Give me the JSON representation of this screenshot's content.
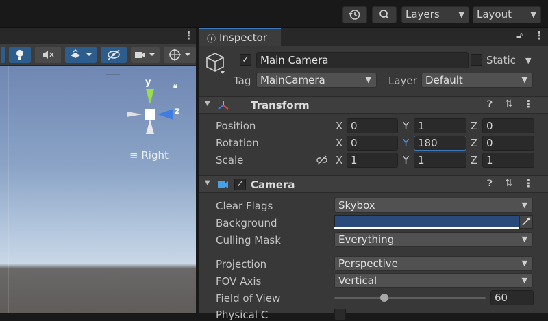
{
  "toolbar": {
    "layers_label": "Layers",
    "layout_label": "Layout"
  },
  "scene": {
    "view_label": "Right",
    "gizmo_y": "y",
    "gizmo_z": "z"
  },
  "inspector": {
    "tab_label": "Inspector",
    "object_name": "Main Camera",
    "static_label": "Static",
    "static_checked": false,
    "active_checked": true,
    "tag_label": "Tag",
    "tag_value": "MainCamera",
    "layer_label": "Layer",
    "layer_value": "Default",
    "transform": {
      "title": "Transform",
      "position_label": "Position",
      "rotation_label": "Rotation",
      "scale_label": "Scale",
      "position": {
        "x": "0",
        "y": "1",
        "z": "0"
      },
      "rotation": {
        "x": "0",
        "y": "180",
        "z": "0"
      },
      "scale": {
        "x": "1",
        "y": "1",
        "z": "1"
      },
      "axis_x": "X",
      "axis_y": "Y",
      "axis_z": "Z"
    },
    "camera": {
      "title": "Camera",
      "enabled": true,
      "clear_flags_label": "Clear Flags",
      "clear_flags_value": "Skybox",
      "background_label": "Background",
      "background_color": "#2b4a7c",
      "culling_mask_label": "Culling Mask",
      "culling_mask_value": "Everything",
      "projection_label": "Projection",
      "projection_value": "Perspective",
      "fov_axis_label": "FOV Axis",
      "fov_axis_value": "Vertical",
      "fov_label": "Field of View",
      "fov_value": "60",
      "fov_range": [
        1,
        179
      ],
      "physical_label": "Physical C"
    }
  },
  "colors": {
    "accent": "#3a79bb",
    "panel": "#383838",
    "field": "#2a2a2a"
  }
}
